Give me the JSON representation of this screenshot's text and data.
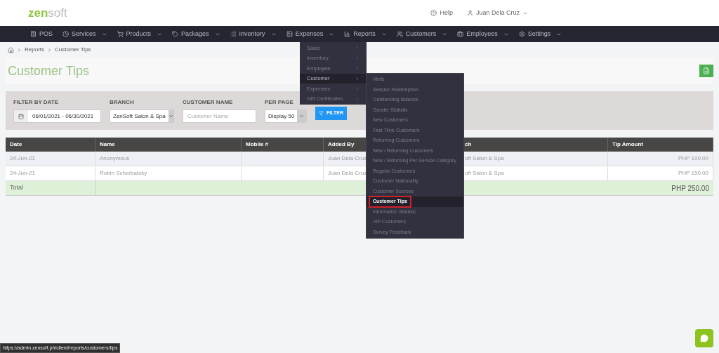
{
  "logo": {
    "bold": "zen",
    "light": "soft"
  },
  "top_links": {
    "help": "Help",
    "user": "Juan Dela Cruz"
  },
  "nav": [
    {
      "label": "POS",
      "dropdown": false
    },
    {
      "label": "Services",
      "dropdown": true
    },
    {
      "label": "Products",
      "dropdown": true
    },
    {
      "label": "Packages",
      "dropdown": true
    },
    {
      "label": "Inventory",
      "dropdown": true
    },
    {
      "label": "Expenses",
      "dropdown": true
    },
    {
      "label": "Reports",
      "dropdown": true
    },
    {
      "label": "Customers",
      "dropdown": true
    },
    {
      "label": "Employees",
      "dropdown": true
    },
    {
      "label": "Settings",
      "dropdown": true
    }
  ],
  "breadcrumb": [
    "Reports",
    "Customer Tips"
  ],
  "page_title": "Customer Tips",
  "filters": {
    "date_label": "FILTER BY DATE",
    "date_value": "06/01/2021 - 06/30/2021",
    "branch_label": "BRANCH",
    "branch_value": "ZenSoft Salon & Spa",
    "customer_label": "CUSTOMER NAME",
    "customer_placeholder": "Customer Name",
    "per_page_label": "PER PAGE",
    "per_page_value": "Display 50",
    "filter_button": "FILTER"
  },
  "table": {
    "columns": [
      "Date",
      "Name",
      "Mobile #",
      "Added By",
      "ch",
      "Tip Amount"
    ],
    "rows": [
      [
        "24-Jun-21",
        "Anonymous",
        "",
        "Juan Dela Cruz",
        "oft Salon & Spa",
        "PHP 100.00"
      ],
      [
        "24-Jun-21",
        "Robin Scherbatzky",
        "",
        "Juan Dela Cruz",
        "oft Salon & Spa",
        "PHP 150.00"
      ]
    ],
    "total_label": "Total",
    "total_value": "PHP 250.00"
  },
  "reports_menu": [
    {
      "label": "Sales",
      "selected": false
    },
    {
      "label": "Inventory",
      "selected": false
    },
    {
      "label": "Employee",
      "selected": false
    },
    {
      "label": "Customer",
      "selected": true
    },
    {
      "label": "Expenses",
      "selected": false
    },
    {
      "label": "Gift Certificates",
      "selected": false
    }
  ],
  "customer_submenu": [
    {
      "label": "Visits",
      "selected": false
    },
    {
      "label": "Session Redemption",
      "selected": false
    },
    {
      "label": "Outstanding Balance",
      "selected": false
    },
    {
      "label": "Gender Statistic",
      "selected": false
    },
    {
      "label": "New Customers",
      "selected": false
    },
    {
      "label": "First Time Customers",
      "selected": false
    },
    {
      "label": "Returning Customers",
      "selected": false
    },
    {
      "label": "New / Returning Customers",
      "selected": false
    },
    {
      "label": "New / Returning Per Service Category",
      "selected": false
    },
    {
      "label": "Regular Customers",
      "selected": false
    },
    {
      "label": "Customer Nationality",
      "selected": false
    },
    {
      "label": "Customer Sources",
      "selected": false
    },
    {
      "label": "Customer Tips",
      "selected": true
    },
    {
      "label": "Information Statistic",
      "selected": false
    },
    {
      "label": "VIP Customers",
      "selected": false
    },
    {
      "label": "Survey Feedback",
      "selected": false
    }
  ],
  "status_url": "https://admin.zensoft.ph/client/reports/customers/tips"
}
